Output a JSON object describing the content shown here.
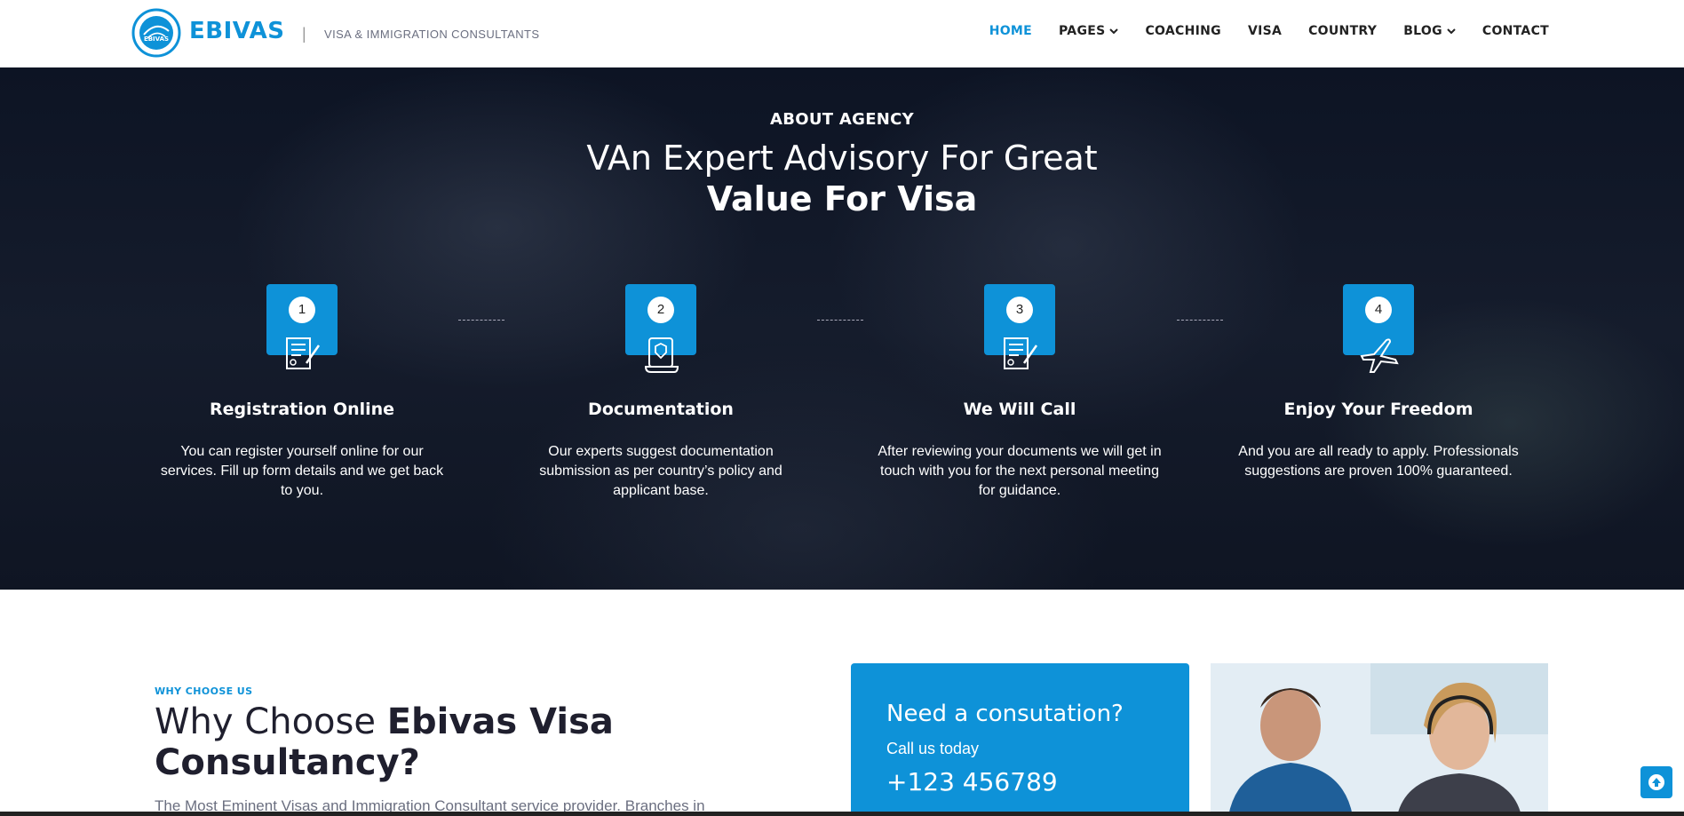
{
  "header": {
    "logo_text": "EBIVAS",
    "brand": "EBIVAS",
    "divider": "|",
    "tagline": "VISA & IMMIGRATION CONSULTANTS",
    "nav": [
      {
        "label": "HOME",
        "active": true,
        "dropdown": false
      },
      {
        "label": "PAGES",
        "active": false,
        "dropdown": true
      },
      {
        "label": "COACHING",
        "active": false,
        "dropdown": false
      },
      {
        "label": "VISA",
        "active": false,
        "dropdown": false
      },
      {
        "label": "COUNTRY",
        "active": false,
        "dropdown": false
      },
      {
        "label": "BLOG",
        "active": false,
        "dropdown": true
      },
      {
        "label": "CONTACT",
        "active": false,
        "dropdown": false
      }
    ]
  },
  "hero": {
    "eyebrow": "ABOUT AGENCY",
    "title_line1": "VAn Expert Advisory For Great",
    "title_line2": "Value For Visa",
    "steps": [
      {
        "number": "1",
        "icon": "document-sign-icon",
        "title": "Registration Online",
        "text": "You can register yourself online for our services. Fill up form details and we get back to you."
      },
      {
        "number": "2",
        "icon": "certificate-scroll-icon",
        "title": "Documentation",
        "text": "Our experts suggest documentation submission as per country’s policy and applicant base."
      },
      {
        "number": "3",
        "icon": "document-sign-icon",
        "title": "We Will Call",
        "text": "After reviewing your documents we will get in touch with you for the next personal meeting for guidance."
      },
      {
        "number": "4",
        "icon": "airplane-icon",
        "title": "Enjoy Your Freedom",
        "text": "And you are all ready to apply. Professionals suggestions are proven 100% guaranteed."
      }
    ]
  },
  "why": {
    "eyebrow": "WHY CHOOSE US",
    "title_light": "Why Choose ",
    "title_bold": "Ebivas Visa Consultancy?",
    "text": "The Most Eminent Visas and Immigration Consultant service provider. Branches in"
  },
  "consult": {
    "title": "Need a consutation?",
    "call": "Call us today",
    "phone": "+123 456789"
  },
  "colors": {
    "accent": "#0e92d8",
    "hero_bg": "#121a2a"
  }
}
